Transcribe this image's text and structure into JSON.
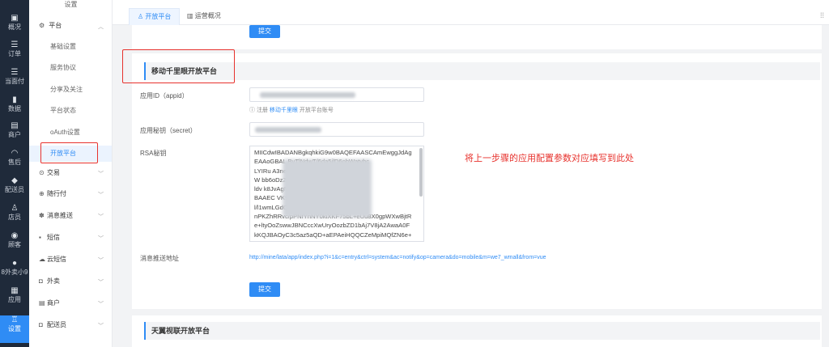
{
  "rail": {
    "items": [
      {
        "label": "概况",
        "icon": "home-icon",
        "glyph": "▣"
      },
      {
        "label": "订单",
        "icon": "list-icon",
        "glyph": "☰"
      },
      {
        "label": "当面付",
        "icon": "list-icon",
        "glyph": "☰"
      },
      {
        "label": "数据",
        "icon": "bar-chart-icon",
        "glyph": "▮"
      },
      {
        "label": "商户",
        "icon": "store-icon",
        "glyph": "▤"
      },
      {
        "label": "售后",
        "icon": "headset-icon",
        "glyph": "◠"
      },
      {
        "label": "配送员",
        "icon": "rider-icon",
        "glyph": "◆"
      },
      {
        "label": "店员",
        "icon": "staff-icon",
        "glyph": "♙"
      },
      {
        "label": "顾客",
        "icon": "customer-icon",
        "glyph": "◉"
      },
      {
        "label": "8外卖小9",
        "icon": "wechat-icon",
        "glyph": "●"
      },
      {
        "label": "应用",
        "icon": "apps-icon",
        "glyph": "▦"
      },
      {
        "label": "设置",
        "icon": "settings-icon",
        "glyph": "♖"
      }
    ],
    "active_index": 11
  },
  "subnav": {
    "top_label": "设置",
    "platform_group": "平台",
    "platform_items": [
      "基础设置",
      "服务协议",
      "分享及关注",
      "平台状态",
      "oAuth设置",
      "开放平台"
    ],
    "active_item": "开放平台",
    "groups": [
      {
        "label": "交易",
        "icon": "trade-icon",
        "glyph": "⊙"
      },
      {
        "label": "随行付",
        "icon": "pay-icon",
        "glyph": "⊕"
      },
      {
        "label": "消息推送",
        "icon": "push-icon",
        "glyph": "✽"
      },
      {
        "label": "短信",
        "icon": "sms-icon",
        "glyph": "▪"
      },
      {
        "label": "云短信",
        "icon": "cloud-icon",
        "glyph": "☁"
      },
      {
        "label": "外卖",
        "icon": "takeout-icon",
        "glyph": "◘"
      },
      {
        "label": "商户",
        "icon": "store-icon",
        "glyph": "▤"
      },
      {
        "label": "配送员",
        "icon": "rider-icon",
        "glyph": "◘"
      }
    ]
  },
  "tabs": [
    {
      "label": "开放平台",
      "icon": "user-icon",
      "glyph": "♙",
      "active": true
    },
    {
      "label": "运营概况",
      "icon": "chart-icon",
      "glyph": "▥",
      "active": false
    }
  ],
  "top_submit_label": "提交",
  "section1": {
    "title": "移动千里眼开放平台",
    "appid_label": "应用ID（appid）",
    "hint_prefix": "注册",
    "hint_link": "移动千里眼",
    "hint_suffix": "开放平台账号",
    "secret_label": "应用秘钥（secret）",
    "rsa_label": "RSA秘钥",
    "rsa_lines": [
      "MIICdwIBADANBgkqhkiG9w0BAQEFAASCAmEwggJdAg",
      "EAAoGBAL             BvTlNdwT/6da5jlD6obWatyhc",
      "LYIRu                              A3negnTGM6F2hb",
      "W                                  bb6oDzZkViM",
      "ldv                                 k8JvAgM",
      "BAAEC                                 VK9CE8iQ",
      "l/l1wmLGdQY                         NtjEp4rOeWj",
      "nPKZhRRvc/pPNfYnNY0kiXKF75bL+eUu8X0gpWXwBjtR",
      "e+ltyOoZswwJBNCccXwUryOozbZD1bAj7V8jA2AwaA0F",
      "kKQJBAOyC3c5az5aQD+aEPAeiHQQCZeMpiMQfZN6e+"
    ],
    "push_label": "消息推送地址",
    "push_url": "http://mine/lata/app/index.php?i=1&c=entry&ctrl=system&ac=notify&op=camera&do=mobile&m=we7_wmall&from=vue",
    "submit_label": "提交"
  },
  "annotation": "将上一步骤的应用配置参数对应填写到此处",
  "section2": {
    "title": "天翼视联开放平台"
  },
  "colors": {
    "accent": "#2f8cf5",
    "rail_bg": "#1f2a3a",
    "highlight": "#e7322d"
  }
}
